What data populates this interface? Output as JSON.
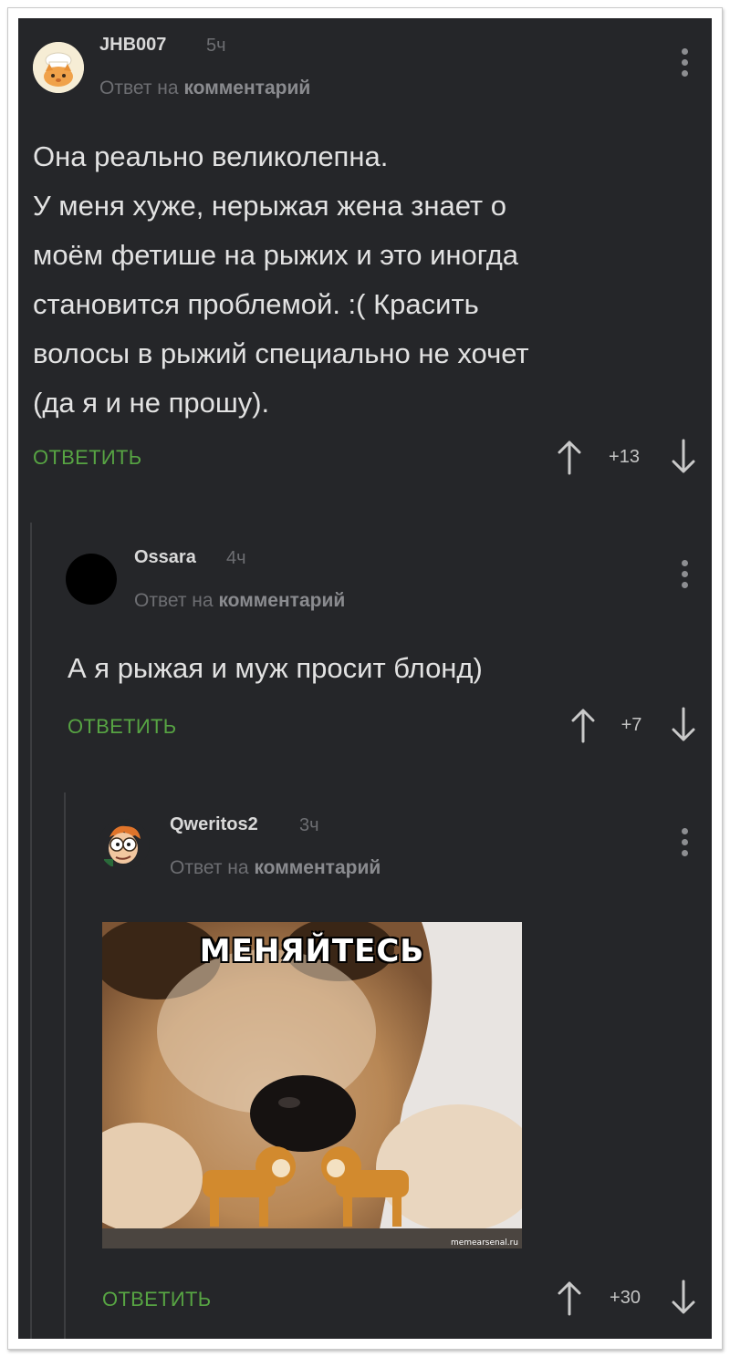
{
  "comments": [
    {
      "username": "JHB007",
      "time": "5ч",
      "reply_prefix": "Ответ на",
      "reply_link": "комментарий",
      "lines": [
        "Она реально великолепна.",
        "У меня хуже, нерыжая жена знает о",
        "моём фетише на рыжих и это иногда",
        "становится проблемой. :( Красить",
        "волосы в рыжий специально не хочет",
        "(да я и не прошу)."
      ],
      "reply_label": "ОТВЕТИТЬ",
      "score": "+13"
    },
    {
      "username": "Ossara",
      "time": "4ч",
      "reply_prefix": "Ответ на",
      "reply_link": "комментарий",
      "lines": [
        "А я рыжая и муж просит блонд)"
      ],
      "reply_label": "ОТВЕТИТЬ",
      "score": "+7"
    },
    {
      "username": "Qweritos2",
      "time": "3ч",
      "reply_prefix": "Ответ на",
      "reply_link": "комментарий",
      "image": {
        "caption": "МЕНЯЙТЕСЬ",
        "watermark": "memearsenal.ru"
      },
      "reply_label": "ОТВЕТИТЬ",
      "score": "+30"
    }
  ],
  "icons": {
    "menu": "more-vertical-icon",
    "upvote": "arrow-up-icon",
    "downvote": "arrow-down-icon"
  },
  "colors": {
    "background": "#252629",
    "accent": "#57a443",
    "text": "#e2e2e2",
    "muted": "#6d6e72"
  }
}
